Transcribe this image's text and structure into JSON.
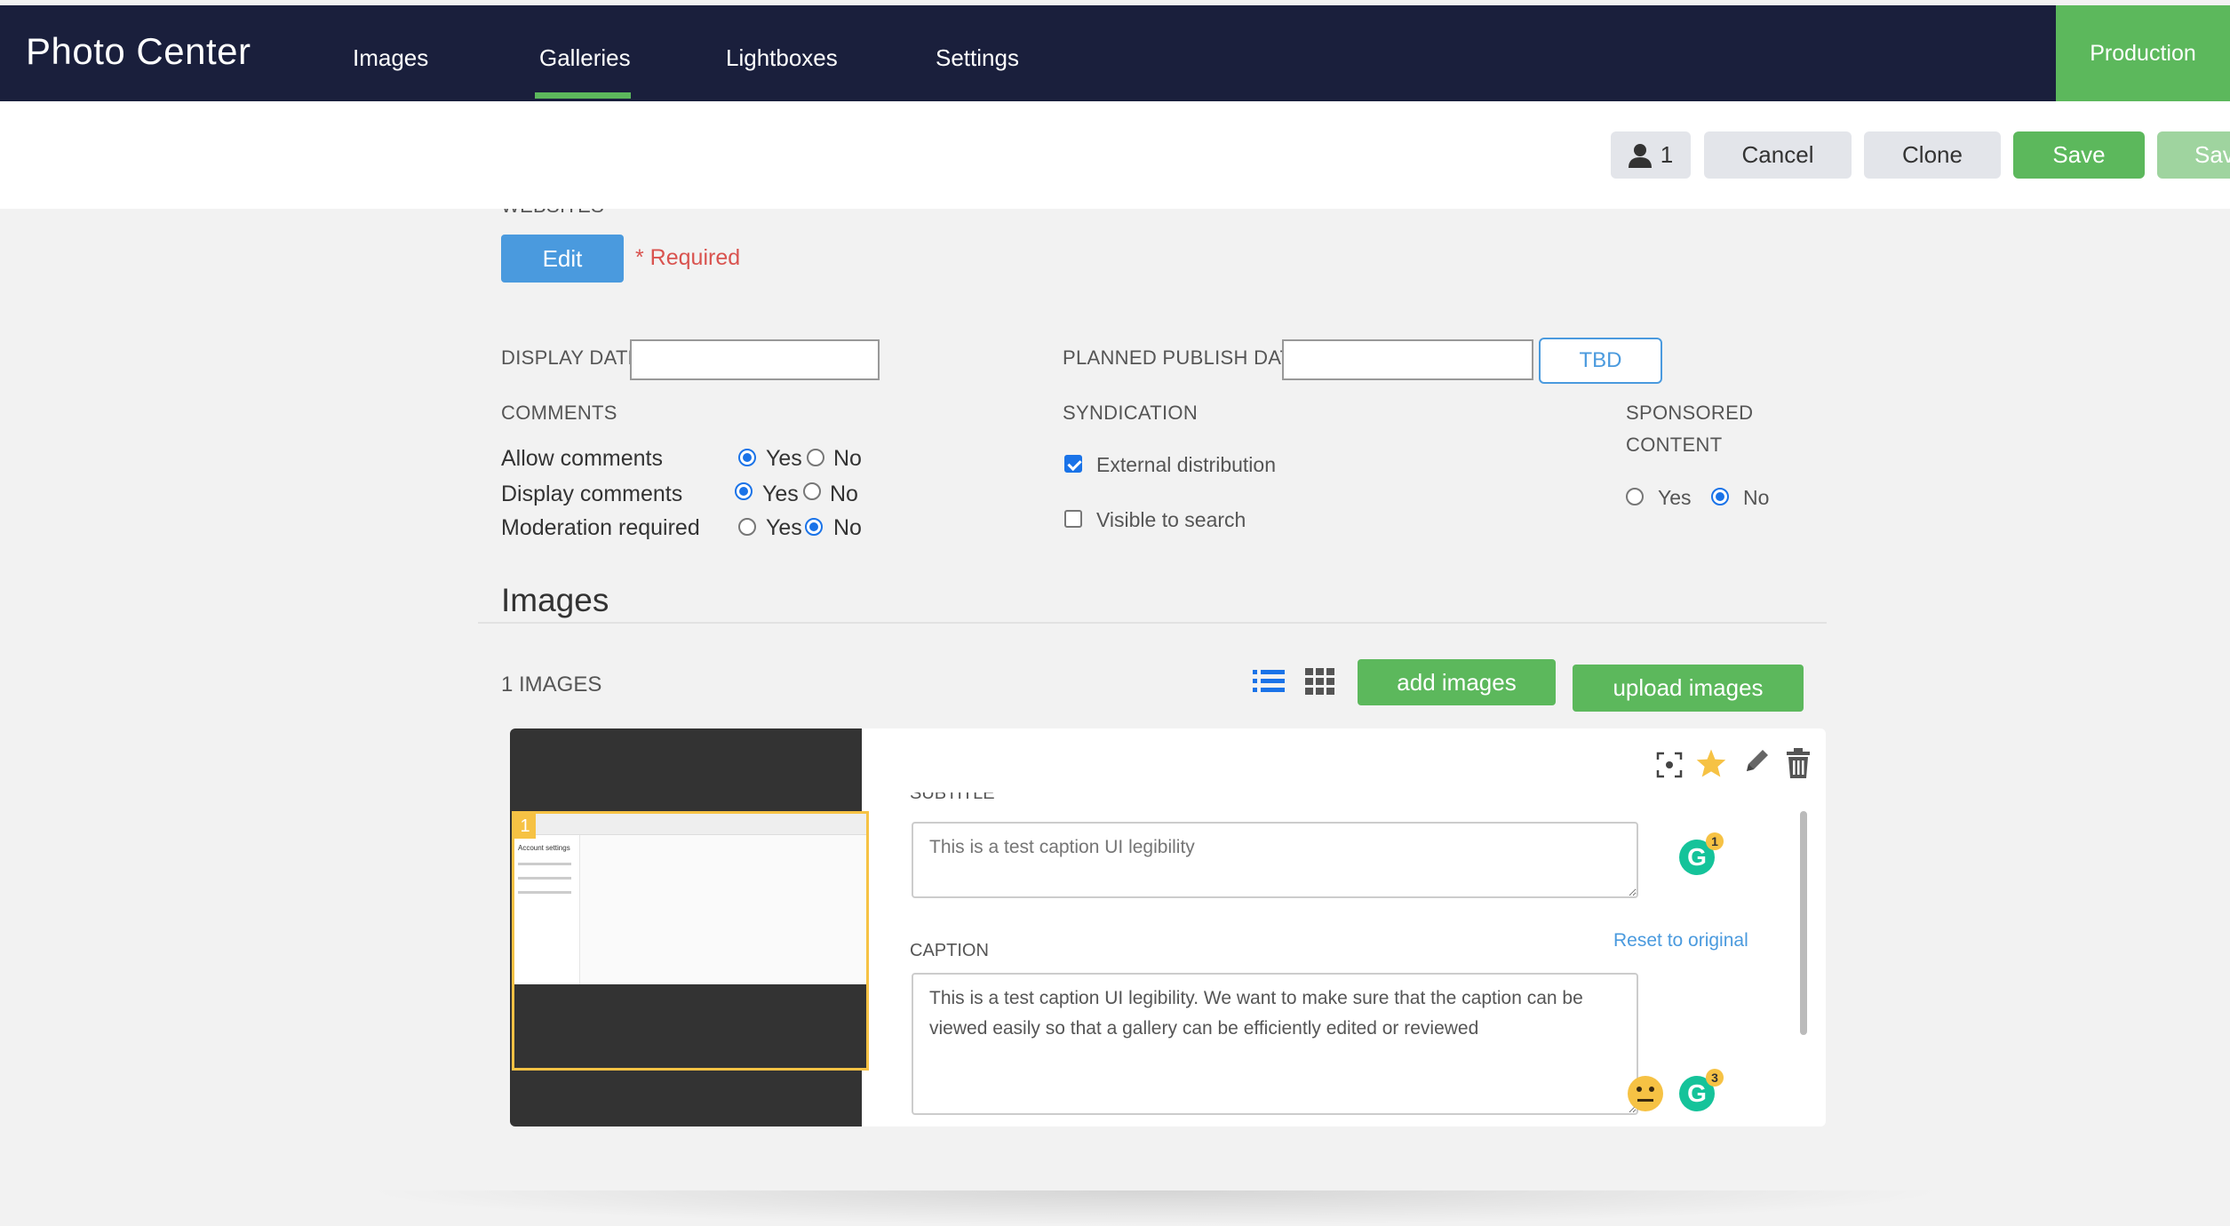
{
  "app": {
    "title": "Photo Center",
    "environment": "Production"
  },
  "nav": {
    "items": [
      "Images",
      "Galleries",
      "Lightboxes",
      "Settings"
    ],
    "active": "Galleries"
  },
  "toolbar": {
    "user_count": "1",
    "cancel": "Cancel",
    "clone": "Clone",
    "save": "Save",
    "save_partial": "Sav"
  },
  "websites": {
    "label": "WEBSITES",
    "edit": "Edit",
    "required": "* Required"
  },
  "dates": {
    "display_date_label": "DISPLAY DATE",
    "display_date_value": "",
    "planned_publish_label": "PLANNED PUBLISH DATE",
    "planned_publish_value": "",
    "tbd": "TBD"
  },
  "comments": {
    "label": "COMMENTS",
    "rows": [
      {
        "label": "Allow comments",
        "value": "Yes"
      },
      {
        "label": "Display comments",
        "value": "Yes"
      },
      {
        "label": "Moderation required",
        "value": "No"
      }
    ],
    "yes": "Yes",
    "no": "No"
  },
  "syndication": {
    "label": "SYNDICATION",
    "external": "External distribution",
    "external_checked": true,
    "visible": "Visible to search",
    "visible_checked": false
  },
  "sponsored": {
    "label_line1": "SPONSORED",
    "label_line2": "CONTENT",
    "yes": "Yes",
    "no": "No",
    "value": "No"
  },
  "images": {
    "heading": "Images",
    "count_label": "1 IMAGES",
    "add": "add images",
    "upload": "upload images",
    "item": {
      "index": "1",
      "subtitle_label": "SUBTITLE",
      "subtitle_placeholder": "This is a test caption UI legibility",
      "subtitle_badge": "1",
      "caption_label": "CAPTION",
      "reset": "Reset to original",
      "caption_value": "This is a test caption UI legibility. We want to make sure that the caption can be viewed easily so that a gallery can be efficiently edited or reviewed",
      "caption_badge": "3",
      "thumb_title": "Account settings"
    }
  },
  "colors": {
    "nav_bg": "#1a1f3c",
    "accent_green": "#5cb85c",
    "edit_blue": "#4a9ade",
    "required_red": "#d9534f",
    "star": "#f6c244"
  }
}
